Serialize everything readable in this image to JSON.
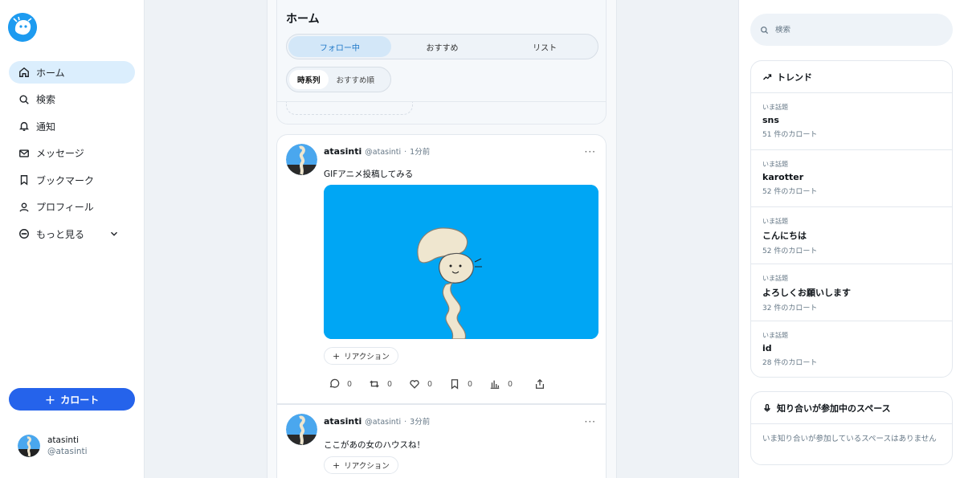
{
  "sidebar": {
    "items": [
      {
        "label": "ホーム",
        "icon": "home-icon",
        "active": true
      },
      {
        "label": "検索",
        "icon": "search-icon"
      },
      {
        "label": "通知",
        "icon": "bell-icon"
      },
      {
        "label": "メッセージ",
        "icon": "mail-icon"
      },
      {
        "label": "ブックマーク",
        "icon": "bookmark-icon"
      },
      {
        "label": "プロフィール",
        "icon": "user-icon"
      },
      {
        "label": "もっと見る",
        "icon": "more-circle-icon"
      }
    ],
    "post_button": "カロート",
    "me": {
      "name": "atasinti",
      "handle": "@atasinti"
    }
  },
  "main": {
    "title": "ホーム",
    "tabs": [
      "フォロー中",
      "おすすめ",
      "リスト"
    ],
    "sort": [
      "時系列",
      "おすすめ順"
    ],
    "posts": [
      {
        "user": "atasinti",
        "handle": "@atasinti",
        "time": "1分前",
        "text": "GIFアニメ投稿してみる",
        "reaction": "リアクション",
        "counts": {
          "reply": "0",
          "repost": "0",
          "like": "0",
          "bookmark": "0",
          "views": "0"
        }
      },
      {
        "user": "atasinti",
        "handle": "@atasinti",
        "time": "3分前",
        "text": "ここがあの女のハウスね！",
        "reaction": "リアクション"
      }
    ],
    "dot_sep": "·",
    "more": "···",
    "plus": "+"
  },
  "right": {
    "search_placeholder": "検索",
    "trends_title": "トレンド",
    "trends": [
      {
        "label": "いま話題",
        "topic": "sns",
        "count": "51 件のカロート"
      },
      {
        "label": "いま話題",
        "topic": "karotter",
        "count": "52 件のカロート"
      },
      {
        "label": "いま話題",
        "topic": "こんにちは",
        "count": "52 件のカロート"
      },
      {
        "label": "いま話題",
        "topic": "よろしくお願いします",
        "count": "32 件のカロート"
      },
      {
        "label": "いま話題",
        "topic": "id",
        "count": "28 件のカロート"
      }
    ],
    "spaces_title": "知り合いが参加中のスペース",
    "spaces_empty": "いま知り合いが参加しているスペースはありません"
  },
  "colors": {
    "accent": "#2563eb",
    "active_bg": "#dbeefd",
    "media_bg": "#00a6f4"
  }
}
